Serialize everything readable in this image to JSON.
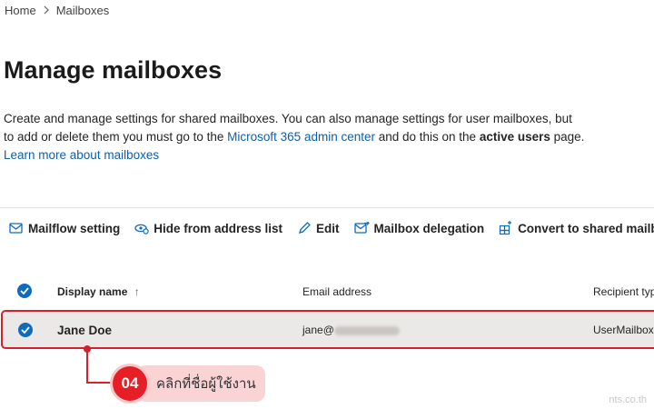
{
  "breadcrumb": {
    "home": "Home",
    "current": "Mailboxes"
  },
  "page": {
    "title": "Manage mailboxes",
    "desc_1": "Create and manage settings for shared mailboxes. You can also manage settings for user mailboxes, but to add or delete them you must go to the ",
    "admin_link": "Microsoft 365 admin center",
    "desc_2": " and do this on the ",
    "active_users": "active users",
    "desc_3": " page. ",
    "learn_link": "Learn more about mailboxes"
  },
  "toolbar": {
    "mailflow": "Mailflow setting",
    "hide": "Hide from address list",
    "edit": "Edit",
    "delegation": "Mailbox delegation",
    "convert": "Convert to shared mailbox"
  },
  "table": {
    "headers": {
      "display_name": "Display name",
      "email": "Email address",
      "recipient": "Recipient type"
    },
    "sort_icon": "↑",
    "rows": [
      {
        "name": "Jane Doe",
        "email_prefix": "jane@",
        "recipient": "UserMailbox"
      }
    ]
  },
  "callout": {
    "number": "04",
    "text": "คลิกที่ชื่อผู้ใช้งาน"
  },
  "watermark": "nts.co.th",
  "colors": {
    "accent": "#0f6cbd",
    "link": "#0f5fa8",
    "highlight": "#d4202f",
    "callout_badge": "#e61e25"
  }
}
